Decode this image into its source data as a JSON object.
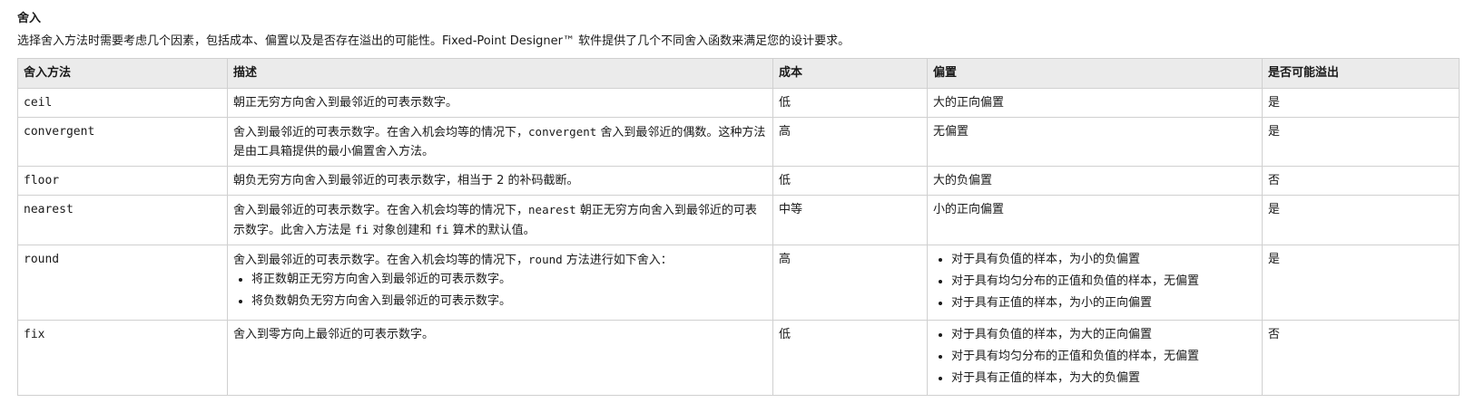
{
  "heading": "舍入",
  "intro": "选择舍入方法时需要考虑几个因素，包括成本、偏置以及是否存在溢出的可能性。Fixed-Point Designer™ 软件提供了几个不同舍入函数来满足您的设计要求。",
  "columns": [
    "舍入方法",
    "描述",
    "成本",
    "偏置",
    "是否可能溢出"
  ],
  "rows": {
    "ceil": {
      "method": "ceil",
      "description": "朝正无穷方向舍入到最邻近的可表示数字。",
      "cost": "低",
      "bias": "大的正向偏置",
      "overflow": "是"
    },
    "convergent": {
      "method": "convergent",
      "desc_a": "舍入到最邻近的可表示数字。在舍入机会均等的情况下，",
      "desc_code": "convergent",
      "desc_b": " 舍入到最邻近的偶数。这种方法是由工具箱提供的最小偏置舍入方法。",
      "cost": "高",
      "bias": "无偏置",
      "overflow": "是"
    },
    "floor": {
      "method": "floor",
      "description": "朝负无穷方向舍入到最邻近的可表示数字，相当于 2 的补码截断。",
      "cost": "低",
      "bias": "大的负偏置",
      "overflow": "否"
    },
    "nearest": {
      "method": "nearest",
      "desc_a": "舍入到最邻近的可表示数字。在舍入机会均等的情况下，",
      "desc_code": "nearest",
      "desc_b": " 朝正无穷方向舍入到最邻近的可表示数字。此舍入方法是 ",
      "desc_code2": "fi",
      "desc_c": " 对象创建和 ",
      "desc_code3": "fi",
      "desc_d": " 算术的默认值。",
      "cost": "中等",
      "bias": "小的正向偏置",
      "overflow": "是"
    },
    "round": {
      "method": "round",
      "desc_a": "舍入到最邻近的可表示数字。在舍入机会均等的情况下，",
      "desc_code": "round",
      "desc_b": " 方法进行如下舍入：",
      "desc_items": [
        "将正数朝正无穷方向舍入到最邻近的可表示数字。",
        "将负数朝负无穷方向舍入到最邻近的可表示数字。"
      ],
      "cost": "高",
      "bias_items": [
        "对于具有负值的样本，为小的负偏置",
        "对于具有均匀分布的正值和负值的样本，无偏置",
        "对于具有正值的样本，为小的正向偏置"
      ],
      "overflow": "是"
    },
    "fix": {
      "method": "fix",
      "description": "舍入到零方向上最邻近的可表示数字。",
      "cost": "低",
      "bias_items": [
        "对于具有负值的样本，为大的正向偏置",
        "对于具有均匀分布的正值和负值的样本，无偏置",
        "对于具有正值的样本，为大的负偏置"
      ],
      "overflow": "否"
    }
  }
}
